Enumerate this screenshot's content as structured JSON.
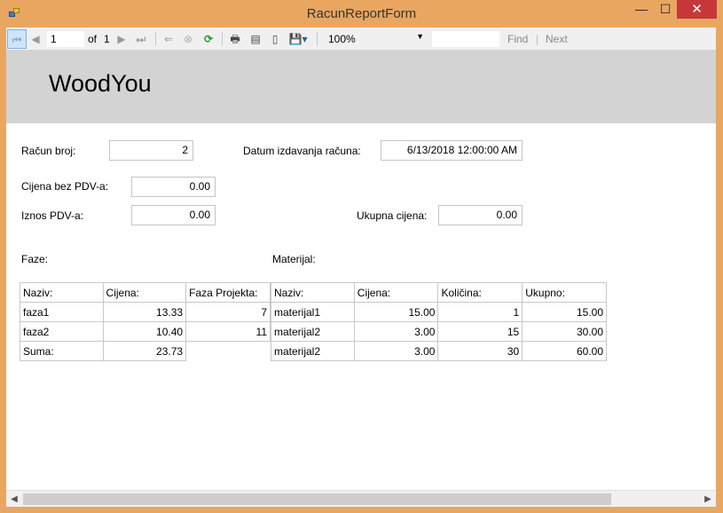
{
  "window": {
    "title": "RacunReportForm",
    "minimize": "—",
    "maximize": "☐",
    "close": "✕"
  },
  "toolbar": {
    "page_current": "1",
    "of_label": "of",
    "page_total": "1",
    "zoom": "100%",
    "search_value": "",
    "find_label": "Find",
    "find_separator": "|",
    "next_label": "Next",
    "icons": {
      "first_page": "⏮",
      "previous_page": "◀",
      "next_page": "▶",
      "last_page": "⏭",
      "back": "⇐",
      "stop": "⊗",
      "refresh": "⟳",
      "print": "🖶",
      "print_layout": "▤",
      "page_setup": "▯",
      "export": "💾▾",
      "zoom_dropdown": "▼"
    }
  },
  "report": {
    "company": "WoodYou",
    "fields": {
      "racun_broj_label": "Račun broj:",
      "racun_broj_value": "2",
      "datum_label": "Datum izdavanja računa:",
      "datum_value": "6/13/2018 12:00:00 AM",
      "cijena_bez_pdv_label": "Cijena bez PDV-a:",
      "cijena_bez_pdv_value": "0.00",
      "iznos_pdv_label": "Iznos PDV-a:",
      "iznos_pdv_value": "0.00",
      "ukupna_cijena_label": "Ukupna cijena:",
      "ukupna_cijena_value": "0.00"
    },
    "faze": {
      "section_label": "Faze:",
      "headers": [
        "Naziv:",
        "Cijena:",
        "Faza Projekta:"
      ],
      "rows": [
        [
          "faza1",
          "13.33",
          "7"
        ],
        [
          "faza2",
          "10.40",
          "11"
        ]
      ],
      "sum_label": "Suma:",
      "sum_value": "23.73"
    },
    "materijal": {
      "section_label": "Materijal:",
      "headers": [
        "Naziv:",
        "Cijena:",
        "Količina:",
        "Ukupno:"
      ],
      "rows": [
        [
          "materijal1",
          "15.00",
          "1",
          "15.00"
        ],
        [
          "materijal2",
          "3.00",
          "15",
          "30.00"
        ],
        [
          "materijal2",
          "3.00",
          "30",
          "60.00"
        ]
      ]
    }
  },
  "scrollbar": {
    "left_arrow": "◀",
    "right_arrow": "▶"
  },
  "colors": {
    "window_frame": "#e9a661",
    "close_button": "#c7373a",
    "report_header": "#d3d3d3"
  }
}
